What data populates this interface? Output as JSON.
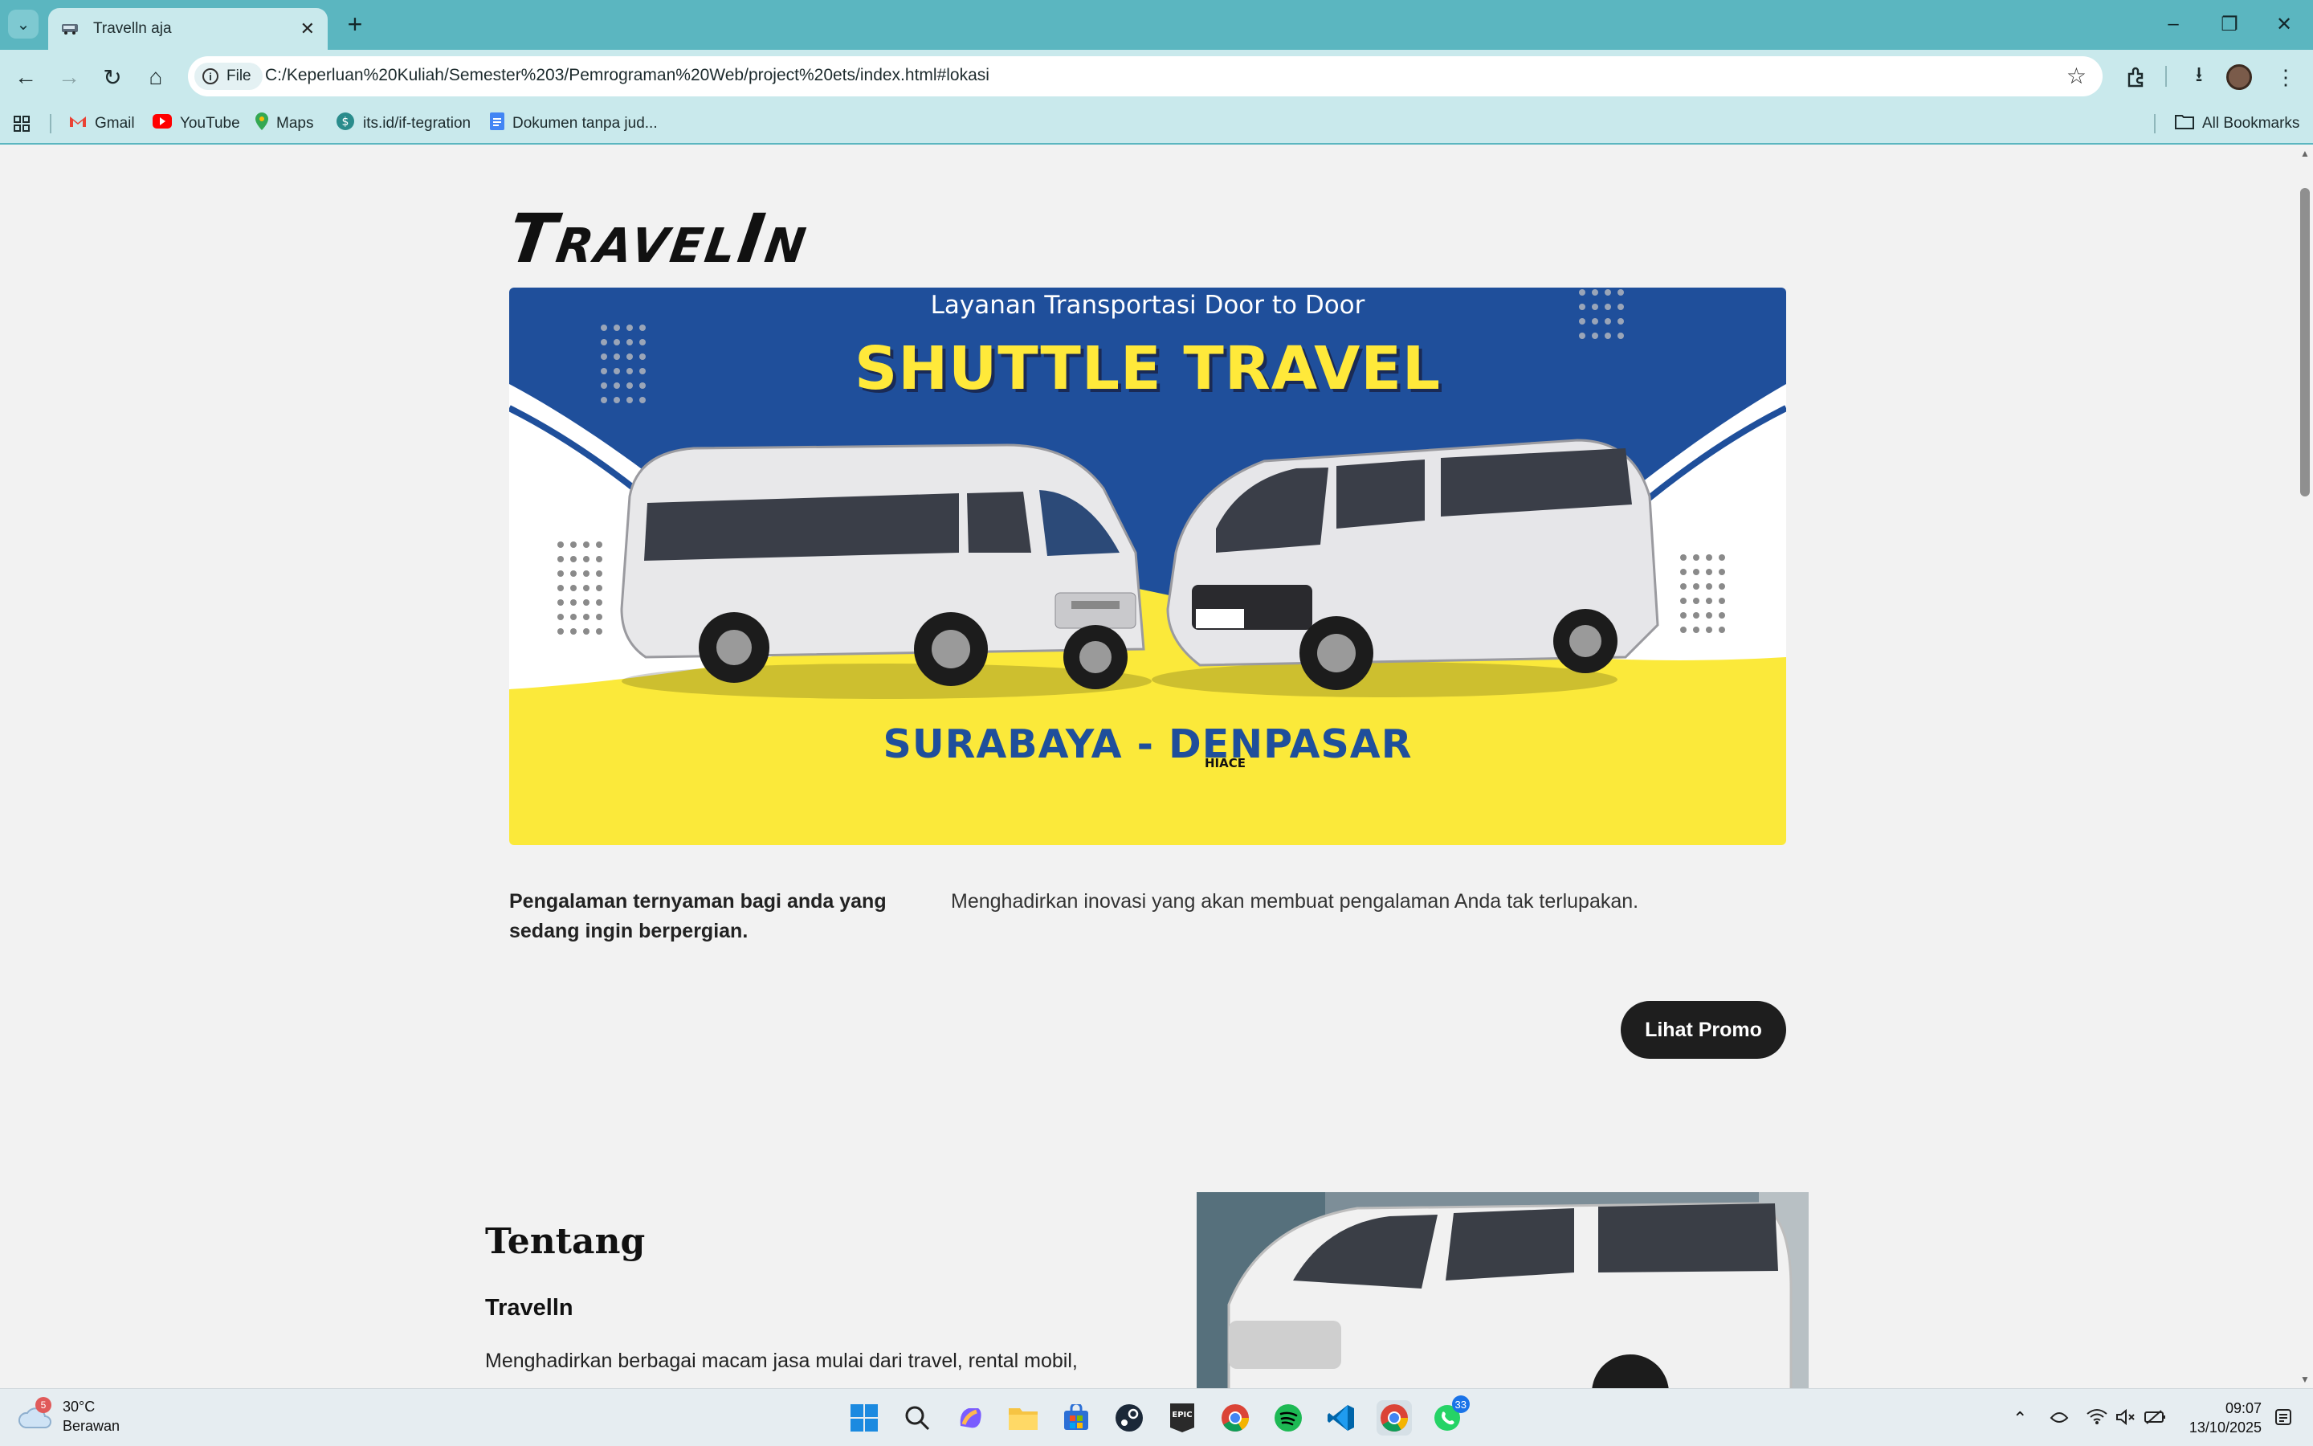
{
  "browser": {
    "tab": {
      "title": "Travelln aja"
    },
    "url": {
      "scheme_label": "File",
      "address": "C:/Keperluan%20Kuliah/Semester%203/Pemrograman%20Web/project%20ets/index.html#lokasi"
    },
    "bookmarks": [
      {
        "label": "Gmail",
        "icon": "gmail-icon"
      },
      {
        "label": "YouTube",
        "icon": "youtube-icon"
      },
      {
        "label": "Maps",
        "icon": "maps-icon"
      },
      {
        "label": "its.id/if-tegration",
        "icon": "link-icon"
      },
      {
        "label": "Dokumen tanpa jud...",
        "icon": "docs-icon"
      }
    ],
    "all_bookmarks_label": "All Bookmarks"
  },
  "page": {
    "logo": "TravelIn",
    "hero": {
      "subtitle": "Layanan Transportasi Door to Door",
      "title": "SHUTTLE TRAVEL",
      "route": "SURABAYA - DENPASAR",
      "van_badge": "HIACE",
      "colors": {
        "blue": "#1f4f9b",
        "yellow": "#fbe93a"
      }
    },
    "intro": {
      "tagline": "Pengalaman ternyaman bagi anda yang sedang ingin berpergian.",
      "description": "Menghadirkan inovasi yang akan membuat pengalaman Anda tak terlupakan."
    },
    "promo_button": "Lihat Promo",
    "about": {
      "heading": "Tentang",
      "subheading": "Travelln",
      "text": "Menghadirkan berbagai macam jasa mulai dari travel, rental mobil,"
    }
  },
  "taskbar": {
    "weather": {
      "temp": "30°C",
      "condition": "Berawan",
      "alert_count": "5"
    },
    "apps": [
      "start-icon",
      "search-icon",
      "copilot-icon",
      "file-explorer-icon",
      "store-icon",
      "steam-icon",
      "epic-games-icon",
      "chrome-icon",
      "spotify-icon",
      "vscode-icon",
      "chrome-active-icon",
      "whatsapp-icon"
    ],
    "whatsapp_badge": "33",
    "clock": {
      "time": "09:07",
      "date": "13/10/2025"
    }
  }
}
